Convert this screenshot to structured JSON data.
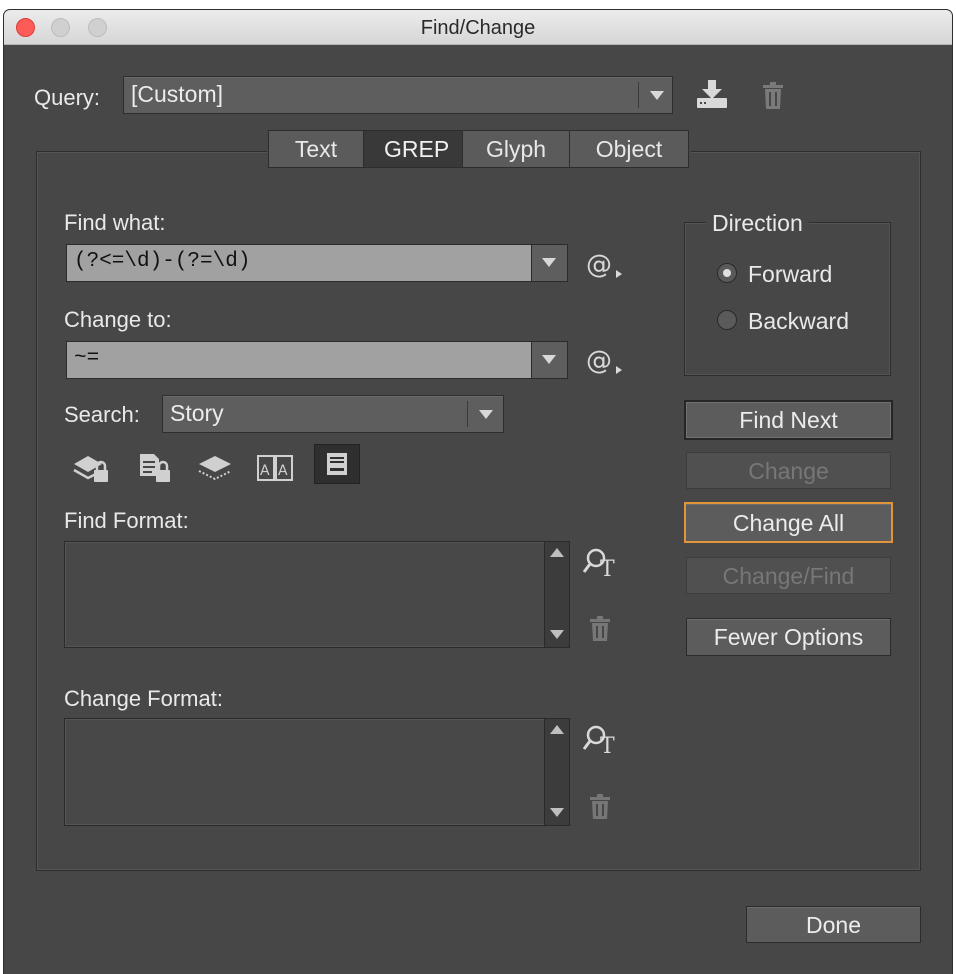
{
  "window": {
    "title": "Find/Change"
  },
  "query": {
    "label": "Query:",
    "value": "[Custom]"
  },
  "tabs": [
    {
      "label": "Text",
      "active": false
    },
    {
      "label": "GREP",
      "active": true
    },
    {
      "label": "Glyph",
      "active": false
    },
    {
      "label": "Object",
      "active": false
    }
  ],
  "find_what": {
    "label": "Find what:",
    "value": "(?<=\\d)-(?=\\d)"
  },
  "change_to": {
    "label": "Change to:",
    "value": "~="
  },
  "search": {
    "label": "Search:",
    "value": "Story"
  },
  "direction": {
    "title": "Direction",
    "options": [
      {
        "label": "Forward",
        "selected": true
      },
      {
        "label": "Backward",
        "selected": false
      }
    ]
  },
  "buttons": {
    "find_next": "Find Next",
    "change": "Change",
    "change_all": "Change All",
    "change_find": "Change/Find",
    "fewer_options": "Fewer Options",
    "done": "Done"
  },
  "find_format": {
    "label": "Find Format:"
  },
  "change_format": {
    "label": "Change Format:"
  },
  "icons": {
    "save_query": "save-query-icon",
    "delete_query": "trash-icon",
    "special_chars": "at-sign-menu-icon",
    "locked_layers": "locked-layers-icon",
    "locked_stories": "locked-stories-icon",
    "hidden_layers": "hidden-layers-icon",
    "master_pages": "master-pages-icon",
    "footnotes": "footnotes-icon",
    "specify_format": "specify-format-icon",
    "clear_format": "trash-icon"
  },
  "colors": {
    "dialog_bg": "#474747",
    "field_bg": "#a1a1a1",
    "focus_ring": "#e2943a",
    "close_button": "#fc5b57"
  }
}
